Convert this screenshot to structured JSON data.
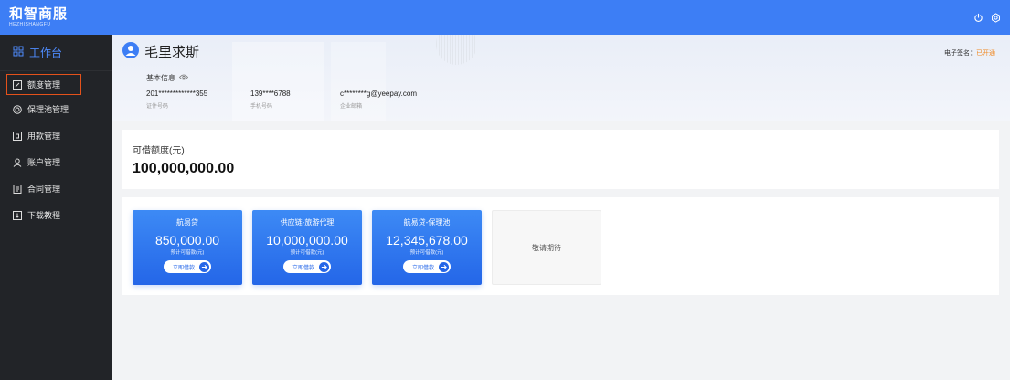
{
  "header": {
    "logo_cn": "和智商服",
    "logo_en": "HEZHISHANGFU",
    "icons": [
      "power-icon",
      "settings-icon"
    ]
  },
  "sidebar": {
    "head_label": "工作台",
    "items": [
      {
        "label": "额度管理",
        "icon": "edit-icon",
        "active": true
      },
      {
        "label": "保理池管理",
        "icon": "pool-icon",
        "active": false
      },
      {
        "label": "用款管理",
        "icon": "document-icon",
        "active": false
      },
      {
        "label": "账户管理",
        "icon": "user-icon",
        "active": false
      },
      {
        "label": "合同管理",
        "icon": "contract-icon",
        "active": false
      },
      {
        "label": "下载教程",
        "icon": "download-icon",
        "active": false
      }
    ]
  },
  "profile": {
    "name": "毛里求斯",
    "esign_label": "电子签名：",
    "esign_status": "已开通",
    "basic_title": "基本信息",
    "fields": [
      {
        "value": "201*************355",
        "label": "证件号码"
      },
      {
        "value": "139****6788",
        "label": "手机号码"
      },
      {
        "value": "c********g@yeepay.com",
        "label": "企业邮箱"
      }
    ]
  },
  "credit": {
    "label": "可借额度(元)",
    "value": "100,000,000.00"
  },
  "products": [
    {
      "title": "航易贷",
      "amount": "850,000.00",
      "sub": "预计可借款(元)",
      "button": "立即借款"
    },
    {
      "title": "供应链-旅游代理",
      "amount": "10,000,000.00",
      "sub": "预计可借款(元)",
      "button": "立即借款"
    },
    {
      "title": "航易贷-保理池",
      "amount": "12,345,678.00",
      "sub": "预计可借款(元)",
      "button": "立即借款"
    }
  ],
  "placeholder_card": "敬请期待",
  "colors": {
    "primary": "#3d7ef5",
    "sidebar_bg": "#222428",
    "active_outline": "#e4521b",
    "esign_ok": "#f08a24"
  }
}
